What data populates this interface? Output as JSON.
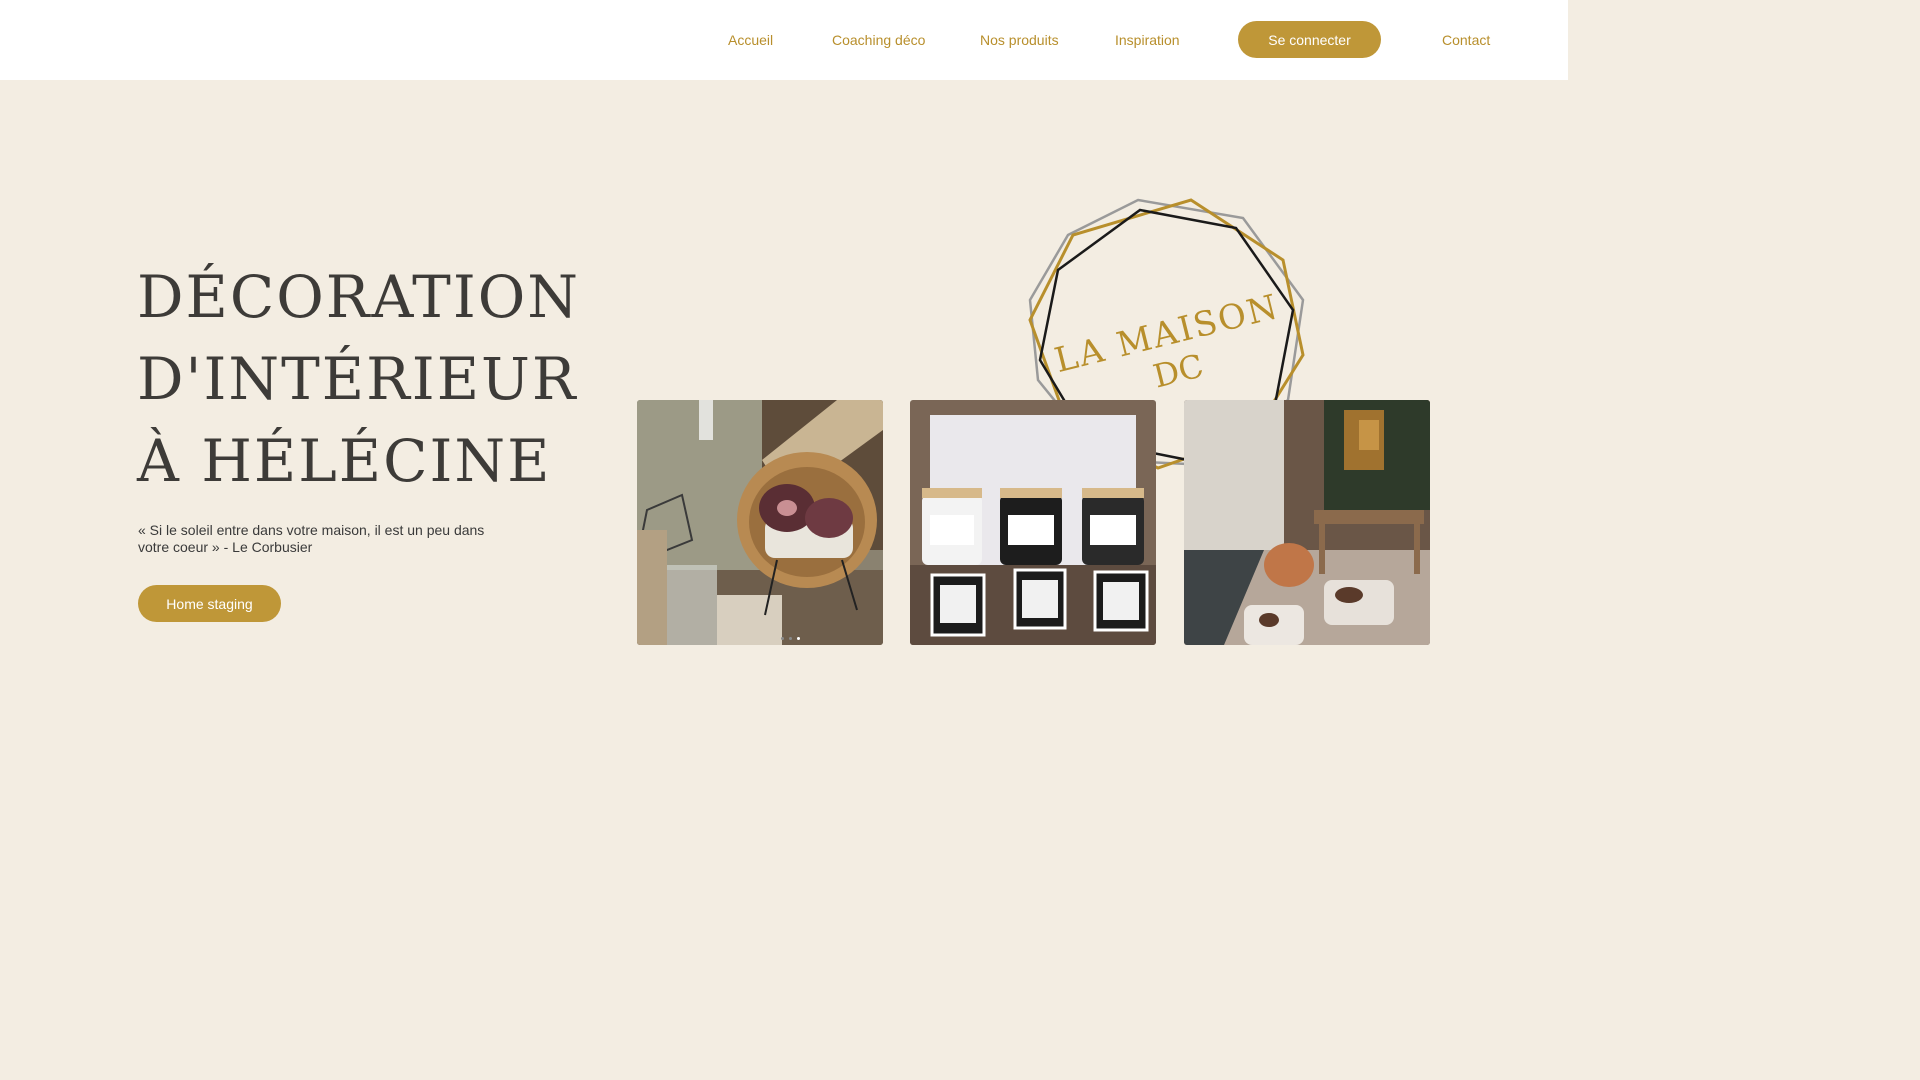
{
  "nav": {
    "items": [
      {
        "label": "Accueil"
      },
      {
        "label": "Coaching déco"
      },
      {
        "label": "Nos produits"
      },
      {
        "label": "Inspiration"
      }
    ],
    "login_label": "Se connecter",
    "contact_label": "Contact"
  },
  "hero": {
    "title_lines": [
      "DÉCORATION",
      "D'INTÉRIEUR",
      "À HÉLÉCINE"
    ],
    "quote": "« Si le soleil entre dans votre maison, il est un peu dans votre coeur » - Le Corbusier",
    "cta_label": "Home staging"
  },
  "logo": {
    "line1": "LA MAISON",
    "line2": "DC",
    "color": "#b88f2c"
  },
  "gallery": {
    "images": [
      {
        "name": "rattan-chair-photo"
      },
      {
        "name": "candles-photo"
      },
      {
        "name": "living-room-photo"
      }
    ],
    "slider_dots": 3,
    "active_dot": 3
  },
  "colors": {
    "accent": "#bf9738",
    "nav_text": "#b88f2c",
    "background": "#f3ede2",
    "header_bg": "#ffffff"
  }
}
